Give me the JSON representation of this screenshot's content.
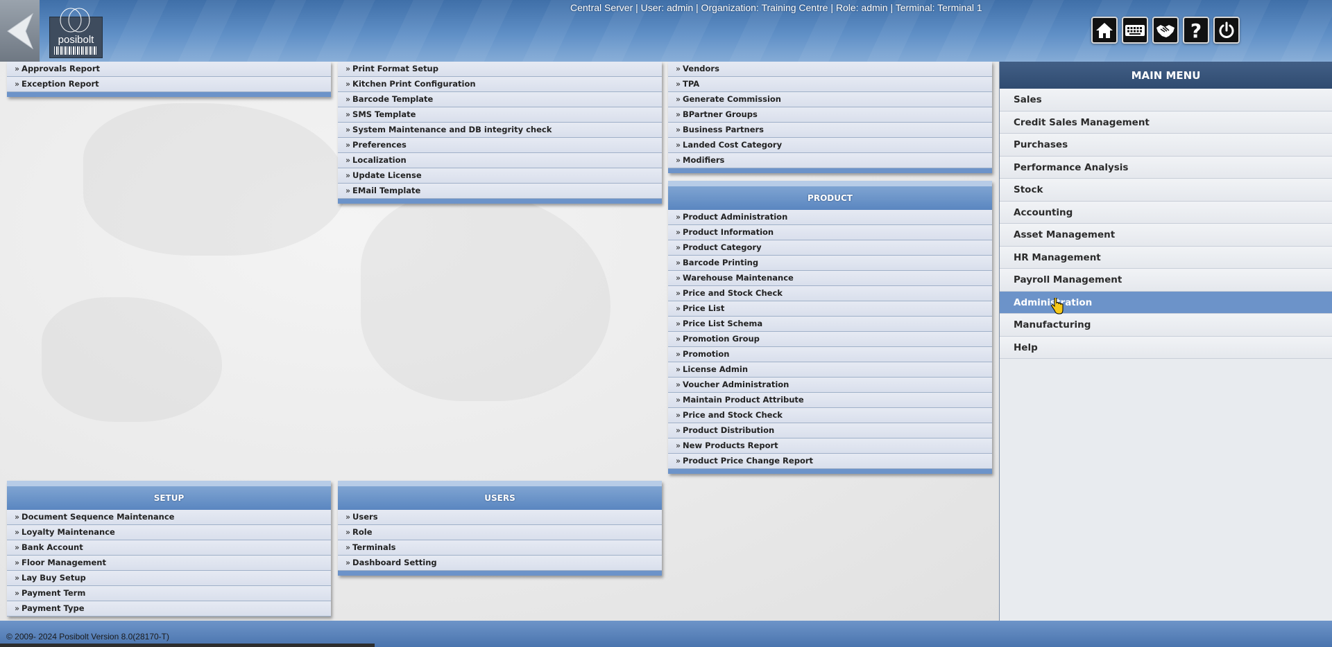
{
  "header": {
    "server_info": "Central Server | User: admin | Organization: Training Centre | Role: admin | Terminal: Terminal 1",
    "logo_text": "posibolt",
    "icons": [
      "home-icon",
      "keyboard-icon",
      "handshake-icon",
      "help-icon",
      "power-icon"
    ]
  },
  "panels": {
    "reports": {
      "items": [
        "Approvals Report",
        "Exception Report"
      ]
    },
    "system": {
      "items": [
        "Print Format Setup",
        "Kitchen Print Configuration",
        "Barcode Template",
        "SMS Template",
        "System Maintenance and DB integrity check",
        "Preferences",
        "Localization",
        "Update License",
        "EMail Template"
      ]
    },
    "partners": {
      "items": [
        "Vendors",
        "TPA",
        "Generate Commission",
        "BPartner Groups",
        "Business Partners",
        "Landed Cost Category",
        "Modifiers"
      ]
    },
    "product": {
      "title": "PRODUCT",
      "items": [
        "Product Administration",
        "Product Information",
        "Product Category",
        "Barcode Printing",
        "Warehouse Maintenance",
        "Price and Stock Check",
        "Price List",
        "Price List Schema",
        "Promotion Group",
        "Promotion",
        "License Admin",
        "Voucher Administration",
        "Maintain Product Attribute",
        "Price and Stock Check",
        "Product Distribution",
        "New Products Report",
        "Product Price Change Report"
      ]
    },
    "setup": {
      "title": "SETUP",
      "items": [
        "Document Sequence Maintenance",
        "Loyalty Maintenance",
        "Bank Account",
        "Floor Management",
        "Lay Buy Setup",
        "Payment Term",
        "Payment Type"
      ]
    },
    "users": {
      "title": "USERS",
      "items": [
        "Users",
        "Role",
        "Terminals",
        "Dashboard Setting"
      ]
    }
  },
  "main_menu": {
    "title": "MAIN MENU",
    "active": "Administration",
    "items": [
      "Sales",
      "Credit Sales Management",
      "Purchases",
      "Performance Analysis",
      "Stock",
      "Accounting",
      "Asset Management",
      "HR Management",
      "Payroll Management",
      "Administration",
      "Manufacturing",
      "Help"
    ]
  },
  "footer": {
    "copyright": "© 2009- 2024 Posibolt Version  8.0(28170-T)"
  },
  "colors": {
    "header_blue": "#4a79b4",
    "panel_title": "#5a86c0",
    "active_menu": "#6c93c9",
    "main_menu_title": "#2f4b70"
  }
}
